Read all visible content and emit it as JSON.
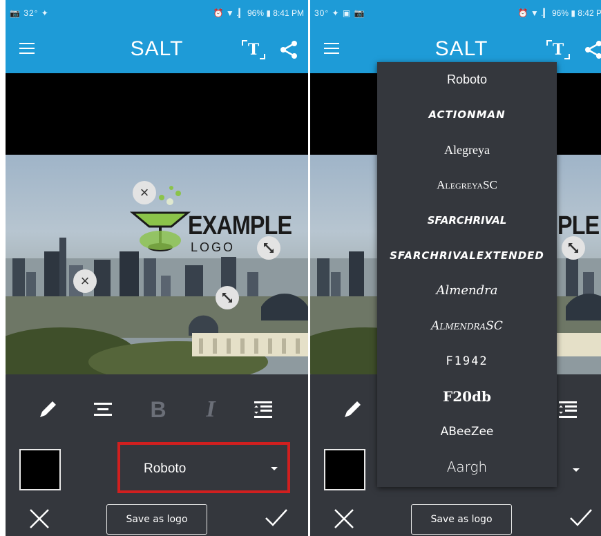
{
  "left_screen": {
    "status": {
      "left": "📷 32° ✦",
      "right": "⏰ ▼ .▎ 96% ▮ 8:41 PM"
    },
    "app_title": "SALT",
    "font_dropdown": {
      "selected": "Roboto",
      "highlight_color": "#d11f1f"
    },
    "save_logo_label": "Save as logo",
    "logo": {
      "line1": "EXAMPLE",
      "line2": "LOGO"
    },
    "text_color": "#000000"
  },
  "right_screen": {
    "status": {
      "left": "30° ✦ ▣ 📷",
      "right": "⏰ ▼ .▎ 96% ▮ 8:42 PM"
    },
    "app_title": "SALT",
    "save_logo_label": "Save as logo",
    "logo": {
      "partial": "PLE"
    },
    "font_options": [
      "Roboto",
      "ACTIONMAN",
      "Alegreya",
      "AlegreyaSC",
      "SFArchRival",
      "SFArchRivalExtended",
      "Almendra",
      "AlmendraSC",
      "F1942",
      "F20db",
      "ABeeZee",
      "Aargh"
    ]
  },
  "colors": {
    "app_bar": "#1e9bd7",
    "toolbar_bg": "#34373d",
    "menu_bg": "#34373d"
  },
  "icons": [
    "menu-icon",
    "font-icon",
    "share-icon",
    "pencil-icon",
    "align-center-icon",
    "bold-icon",
    "italic-icon",
    "line-spacing-icon",
    "close-icon",
    "check-icon",
    "resize-icon",
    "dropdown-caret-icon"
  ]
}
